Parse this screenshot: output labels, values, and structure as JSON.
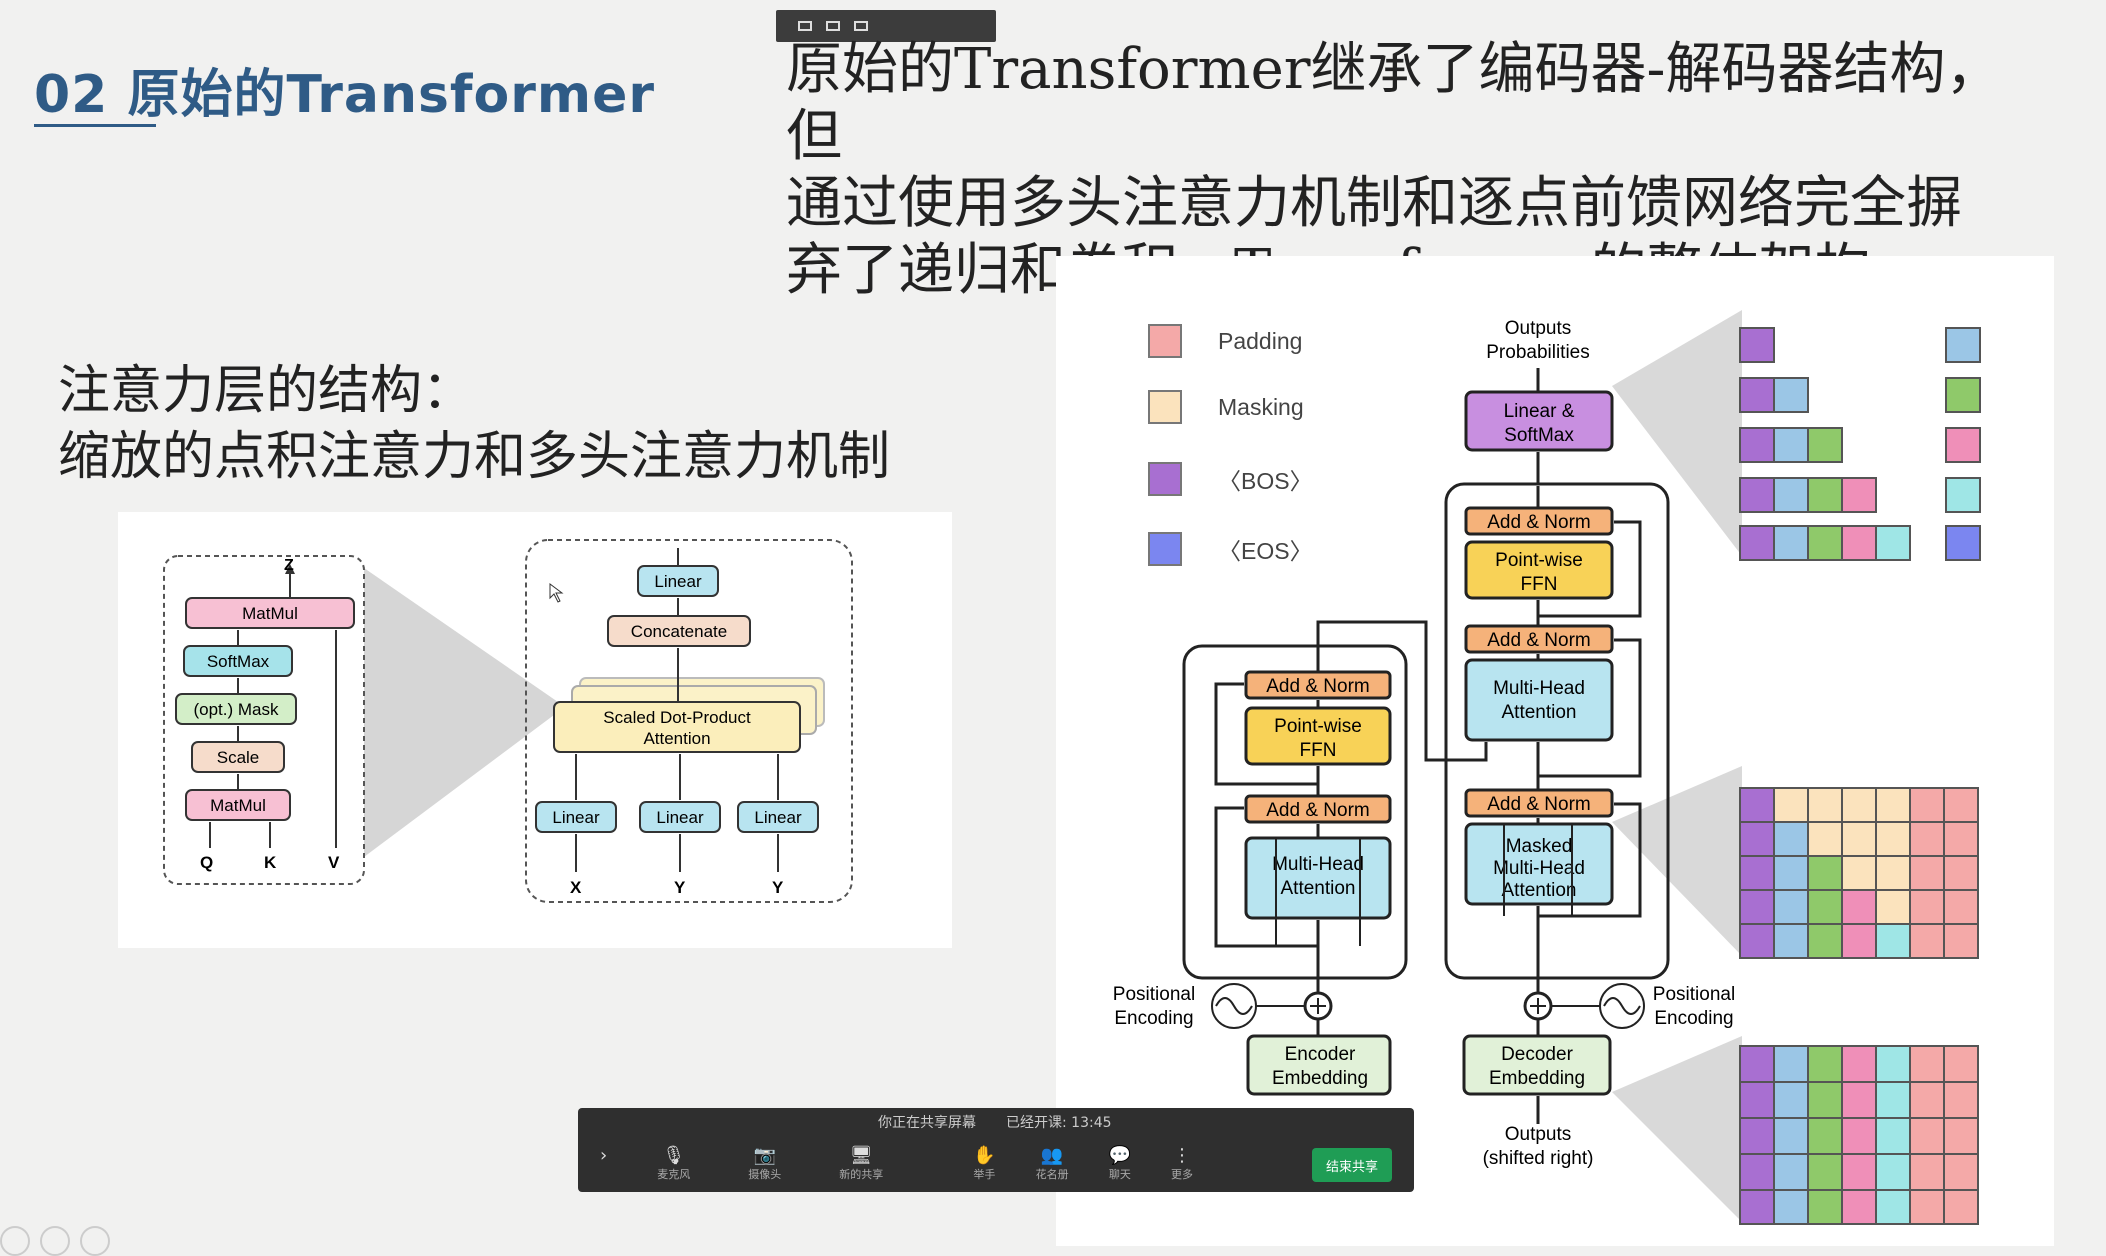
{
  "slide": {
    "title": "02   原始的Transformer",
    "intro_line1": "原始的Transformer继承了编码器-解码器结构，但",
    "intro_line2": "通过使用多头注意力机制和逐点前馈网络完全摒",
    "intro_line3": "弃了递归和卷积。Transformer的整体架构",
    "subtitle_line1": "注意力层的结构：",
    "subtitle_line2": "缩放的点积注意力和多头注意力机制"
  },
  "attention_diagram": {
    "sdpa": {
      "out": "Z",
      "matmul_top": "MatMul",
      "softmax": "SoftMax",
      "mask": "(opt.) Mask",
      "scale": "Scale",
      "matmul_bottom": "MatMul",
      "q": "Q",
      "k": "K",
      "v": "V"
    },
    "mha": {
      "linear_top": "Linear",
      "concat": "Concatenate",
      "sdpa": "Scaled Dot-Product",
      "sdpa2": "Attention",
      "linear1": "Linear",
      "linear2": "Linear",
      "linear3": "Linear",
      "x": "X",
      "y1": "Y",
      "y2": "Y"
    }
  },
  "arch_diagram": {
    "legend": [
      {
        "label": "Padding",
        "color": "#f4a9a8"
      },
      {
        "label": "Masking",
        "color": "#fbe3bd"
      },
      {
        "label": "〈BOS〉",
        "color": "#a86fd1"
      },
      {
        "label": "〈EOS〉",
        "color": "#7b86f0"
      }
    ],
    "outputs_probs_1": "Outputs",
    "outputs_probs_2": "Probabilities",
    "linear_softmax_1": "Linear &",
    "linear_softmax_2": "SoftMax",
    "add_norm": "Add & Norm",
    "ffn_1": "Point-wise",
    "ffn_2": "FFN",
    "mha_1": "Multi-Head",
    "mha_2": "Attention",
    "masked_1": "Masked",
    "masked_2": "Multi-Head",
    "masked_3": "Attention",
    "pos_enc_1": "Positional",
    "pos_enc_2": "Encoding",
    "enc_emb_1": "Encoder",
    "enc_emb_2": "Embedding",
    "dec_emb_1": "Decoder",
    "dec_emb_2": "Embedding",
    "outputs_shift_1": "Outputs",
    "outputs_shift_2": "(shifted right)"
  },
  "meeting_bar": {
    "status_sharing": "你正在共享屏幕",
    "status_time": "已经开课: 13:45",
    "items": [
      {
        "icon": "›",
        "label": ""
      },
      {
        "icon": "🎙",
        "label": "麦克风"
      },
      {
        "icon": "📷",
        "label": "摄像头"
      },
      {
        "icon": "🖥",
        "label": "新的共享"
      },
      {
        "icon": "✋",
        "label": "举手"
      },
      {
        "icon": "👥",
        "label": "花名册"
      },
      {
        "icon": "💬",
        "label": "聊天"
      },
      {
        "icon": "⋮",
        "label": "更多"
      }
    ],
    "end_share": "结束共享"
  }
}
